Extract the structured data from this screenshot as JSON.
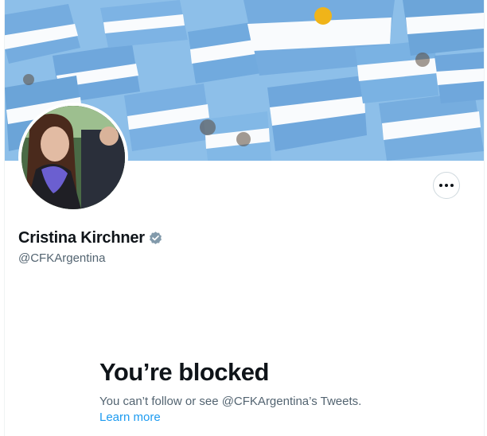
{
  "profile": {
    "display_name": "Cristina Kirchner",
    "handle": "@CFKArgentina",
    "verified": true,
    "banner_icon": "argentina-flags-banner",
    "avatar_icon": "profile-photo"
  },
  "actions": {
    "more_icon": "more-horizontal-icon"
  },
  "blocked": {
    "title": "You’re blocked",
    "message": "You can’t follow or see @CFKArgentina’s Tweets.",
    "learn_more": "Learn more"
  },
  "colors": {
    "link": "#1d9bf0",
    "verified_badge": "#829aab",
    "secondary_text": "#536471",
    "flag_blue": "#74acdf",
    "flag_sun": "#f6b40e"
  }
}
